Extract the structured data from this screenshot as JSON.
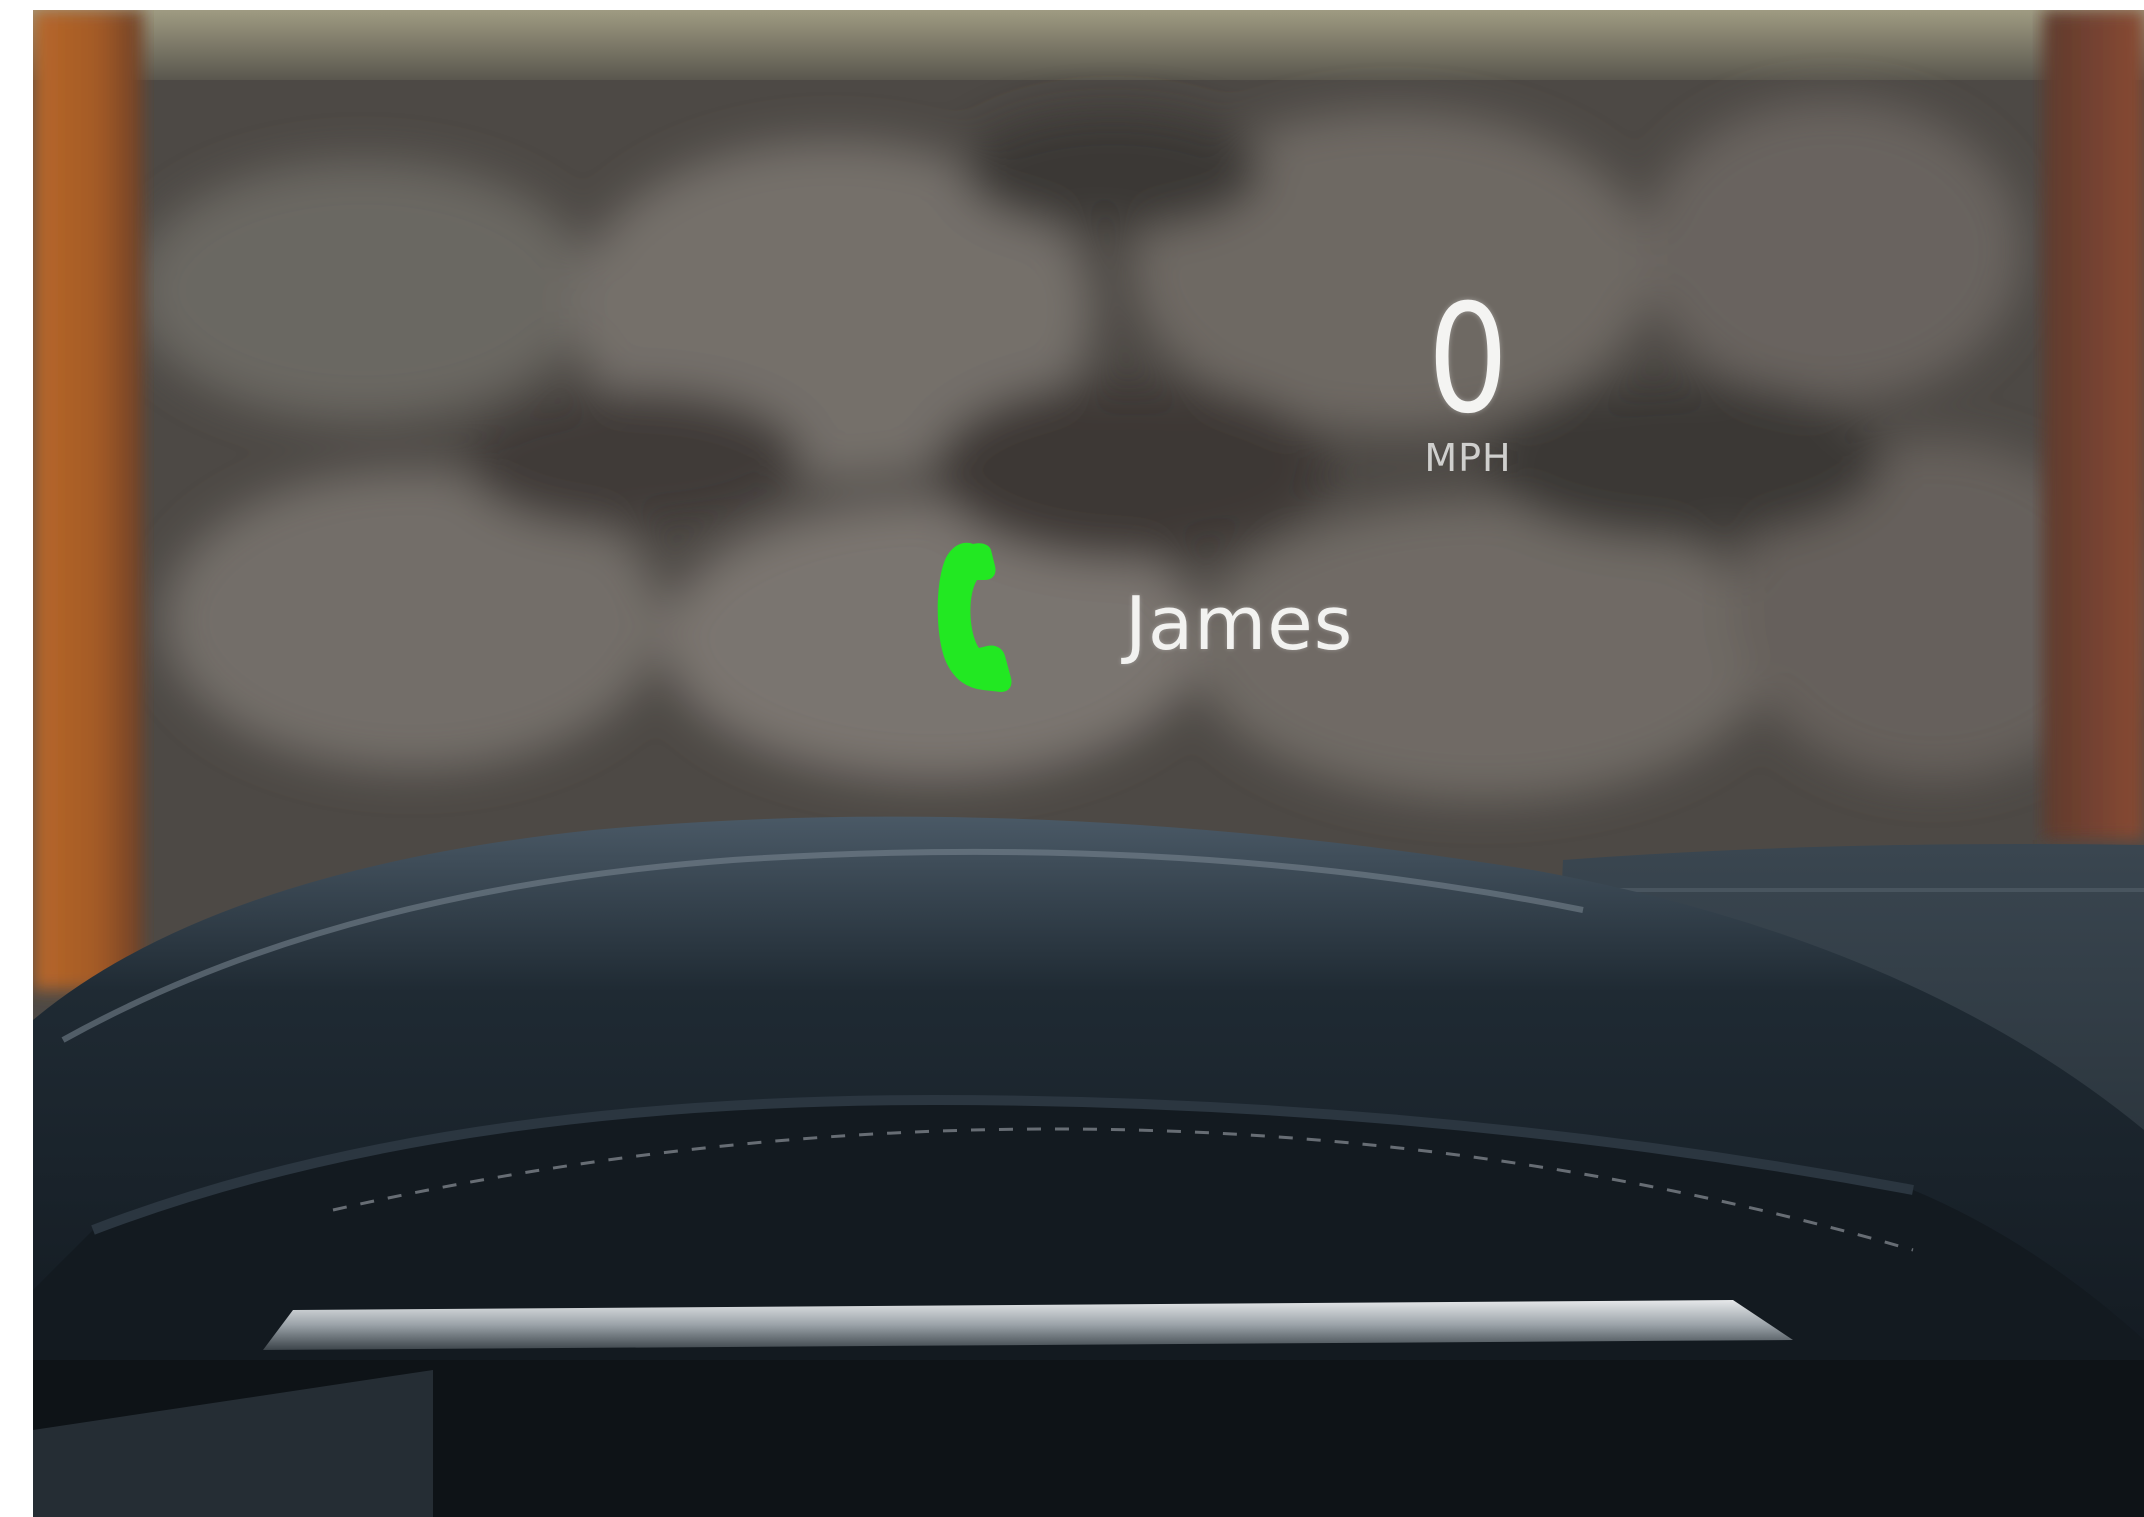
{
  "hud": {
    "speed": {
      "value": "0",
      "unit": "MPH"
    },
    "call": {
      "icon": "phone-icon",
      "caller_name": "James",
      "icon_color": "#22e822"
    }
  },
  "colors": {
    "hud_text": "#f4f4f2",
    "call_icon": "#22e822"
  }
}
